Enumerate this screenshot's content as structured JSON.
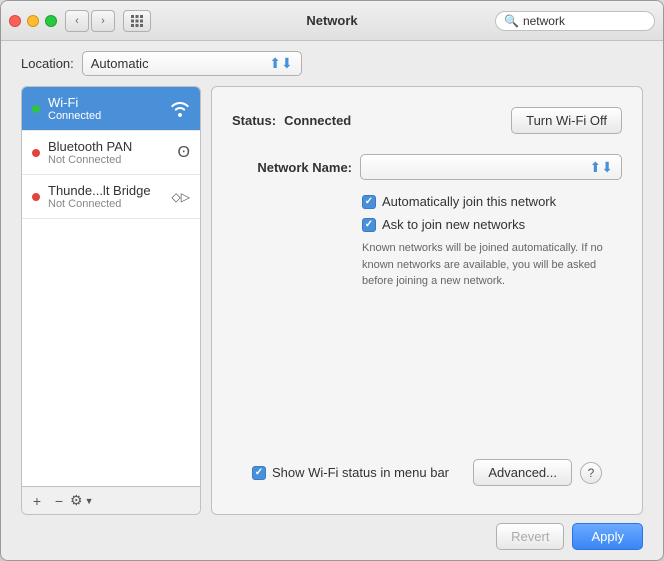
{
  "window": {
    "title": "Network"
  },
  "titlebar": {
    "back_label": "‹",
    "forward_label": "›",
    "grid_icon": "⊞",
    "search_placeholder": "network",
    "search_clear": "✕"
  },
  "location": {
    "label": "Location:",
    "value": "Automatic",
    "arrow": "▲▼"
  },
  "sidebar": {
    "items": [
      {
        "name": "Wi-Fi",
        "status": "Connected",
        "dot": "green",
        "active": true,
        "icon": "wifi"
      },
      {
        "name": "Bluetooth PAN",
        "status": "Not Connected",
        "dot": "red",
        "active": false,
        "icon": "bluetooth"
      },
      {
        "name": "Thunde...lt Bridge",
        "status": "Not Connected",
        "dot": "red",
        "active": false,
        "icon": "thunderbolt"
      }
    ],
    "toolbar": {
      "add": "+",
      "remove": "−",
      "gear": "⚙"
    }
  },
  "detail": {
    "status_label": "Status:",
    "status_value": "Connected",
    "turn_off_btn": "Turn Wi-Fi Off",
    "network_name_label": "Network Name:",
    "checkbox1_label": "Automatically join this network",
    "checkbox2_label": "Ask to join new networks",
    "info_text": "Known networks will be joined automatically. If no known networks are available, you will be asked before joining a new network.",
    "show_wifi_label": "Show Wi-Fi status in menu bar",
    "advanced_btn": "Advanced...",
    "help": "?",
    "revert_btn": "Revert",
    "apply_btn": "Apply"
  },
  "colors": {
    "accent": "#4a90d9",
    "sidebar_active": "#4a90d9",
    "dot_green": "#2dc73e",
    "dot_red": "#e0443a"
  }
}
